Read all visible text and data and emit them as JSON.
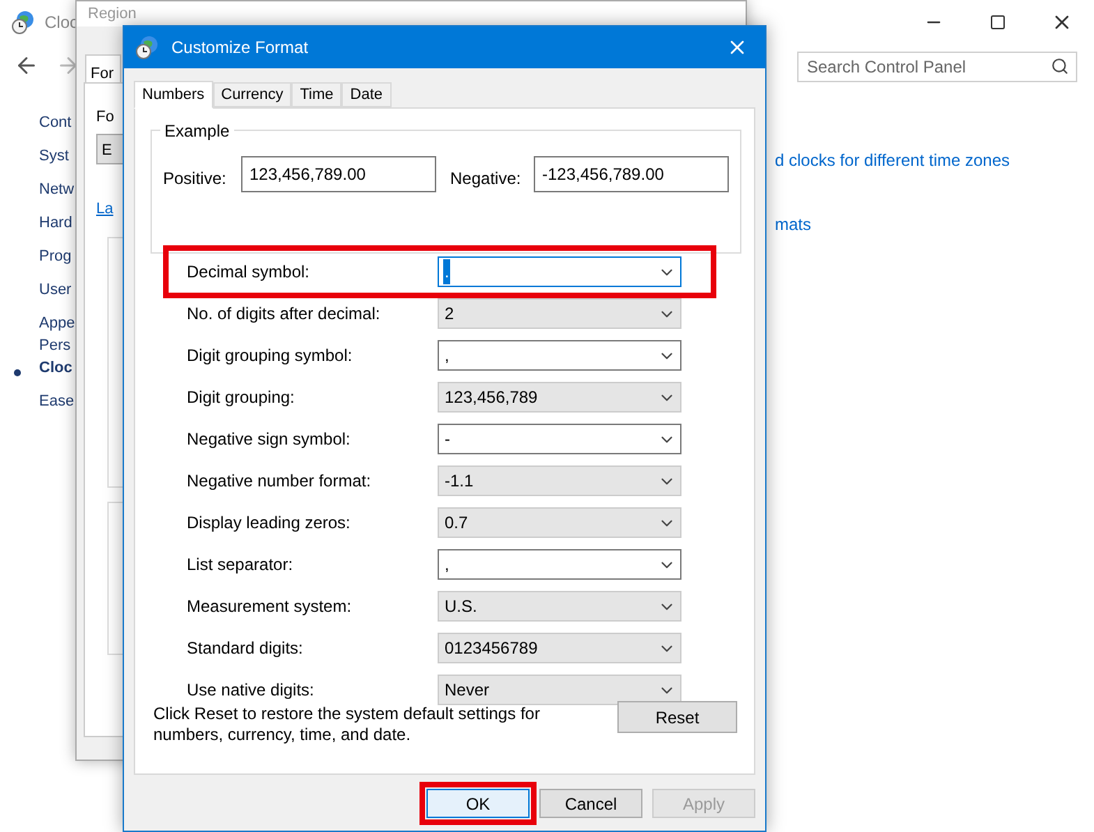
{
  "control_panel": {
    "title": "Cloc",
    "search": {
      "placeholder": "Search Control Panel"
    },
    "sidebar": [
      {
        "label": "Cont",
        "current": false
      },
      {
        "label": "Syst",
        "current": false
      },
      {
        "label": "Netw",
        "current": false
      },
      {
        "label": "Hard",
        "current": false
      },
      {
        "label": "Prog",
        "current": false
      },
      {
        "label": "User",
        "current": false
      },
      {
        "label": "Appe\nPers",
        "current": false
      },
      {
        "label": "Cloc",
        "current": true
      },
      {
        "label": "Ease",
        "current": false
      }
    ],
    "links": [
      "d clocks for different time zones",
      "mats"
    ]
  },
  "region": {
    "title": "Region",
    "tab": "For",
    "format_label": "Fo",
    "format_value": "E",
    "link": "La"
  },
  "dialog": {
    "title": "Customize Format",
    "tabs": [
      {
        "label": "Numbers",
        "selected": true
      },
      {
        "label": "Currency",
        "selected": false
      },
      {
        "label": "Time",
        "selected": false
      },
      {
        "label": "Date",
        "selected": false
      }
    ],
    "example": {
      "title": "Example",
      "positive_label": "Positive:",
      "positive": "123,456,789.00",
      "negative_label": "Negative:",
      "negative": "-123,456,789.00"
    },
    "settings": [
      {
        "label": "Decimal symbol:",
        "value": ".",
        "kind": "editable",
        "focused": true,
        "highlighted": true
      },
      {
        "label": "No. of digits after decimal:",
        "value": "2",
        "kind": "list",
        "focused": false,
        "highlighted": false
      },
      {
        "label": "Digit grouping symbol:",
        "value": ",",
        "kind": "editable",
        "focused": false,
        "highlighted": false
      },
      {
        "label": "Digit grouping:",
        "value": "123,456,789",
        "kind": "list",
        "focused": false,
        "highlighted": false
      },
      {
        "label": "Negative sign symbol:",
        "value": "-",
        "kind": "editable",
        "focused": false,
        "highlighted": false
      },
      {
        "label": "Negative number format:",
        "value": "-1.1",
        "kind": "list",
        "focused": false,
        "highlighted": false
      },
      {
        "label": "Display leading zeros:",
        "value": "0.7",
        "kind": "list",
        "focused": false,
        "highlighted": false
      },
      {
        "label": "List separator:",
        "value": ",",
        "kind": "editable",
        "focused": false,
        "highlighted": false
      },
      {
        "label": "Measurement system:",
        "value": "U.S.",
        "kind": "list",
        "focused": false,
        "highlighted": false
      },
      {
        "label": "Standard digits:",
        "value": "0123456789",
        "kind": "list",
        "focused": false,
        "highlighted": false
      },
      {
        "label": "Use native digits:",
        "value": "Never",
        "kind": "list",
        "focused": false,
        "highlighted": false
      }
    ],
    "reset_note": "Click Reset to restore the system default settings for numbers, currency, time, and date.",
    "reset_button": "Reset",
    "buttons": [
      {
        "label": "OK",
        "disabled": false,
        "highlighted": true
      },
      {
        "label": "Cancel",
        "disabled": false,
        "highlighted": false
      },
      {
        "label": "Apply",
        "disabled": true,
        "highlighted": false
      }
    ]
  }
}
